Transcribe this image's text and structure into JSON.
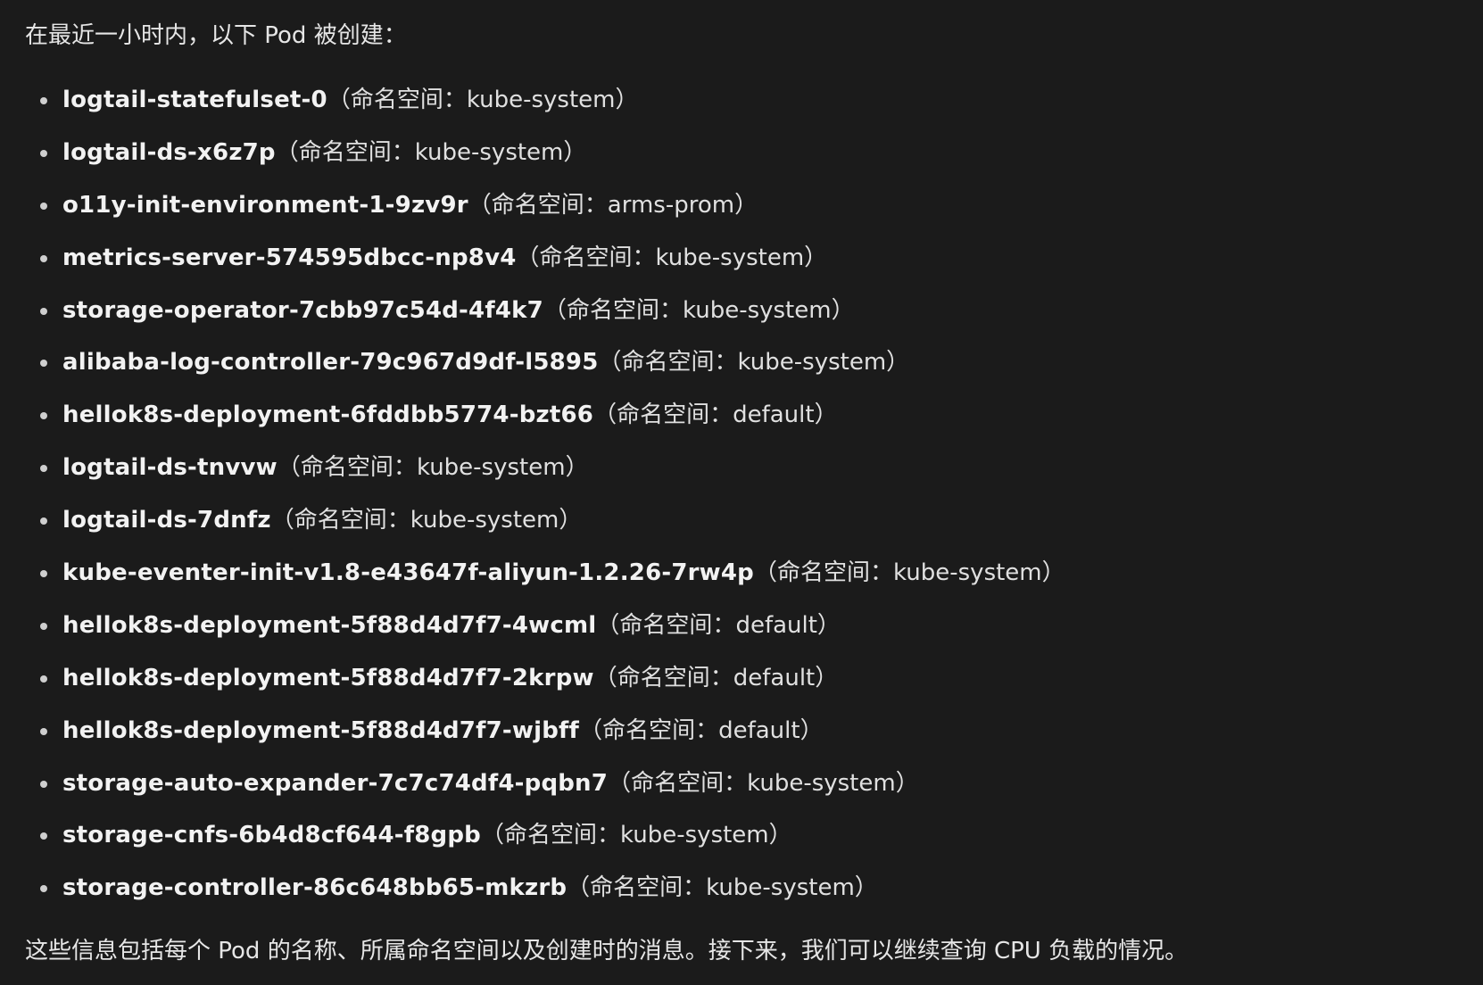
{
  "intro": "在最近一小时内，以下 Pod 被创建：",
  "ns_prefix": "（命名空间：",
  "ns_suffix": "）",
  "pods": [
    {
      "name": "logtail-statefulset-0",
      "namespace": "kube-system"
    },
    {
      "name": "logtail-ds-x6z7p",
      "namespace": "kube-system"
    },
    {
      "name": "o11y-init-environment-1-9zv9r",
      "namespace": "arms-prom"
    },
    {
      "name": "metrics-server-574595dbcc-np8v4",
      "namespace": "kube-system"
    },
    {
      "name": "storage-operator-7cbb97c54d-4f4k7",
      "namespace": "kube-system"
    },
    {
      "name": "alibaba-log-controller-79c967d9df-l5895",
      "namespace": "kube-system"
    },
    {
      "name": "hellok8s-deployment-6fddbb5774-bzt66",
      "namespace": "default"
    },
    {
      "name": "logtail-ds-tnvvw",
      "namespace": "kube-system"
    },
    {
      "name": "logtail-ds-7dnfz",
      "namespace": "kube-system"
    },
    {
      "name": "kube-eventer-init-v1.8-e43647f-aliyun-1.2.26-7rw4p",
      "namespace": "kube-system"
    },
    {
      "name": "hellok8s-deployment-5f88d4d7f7-4wcml",
      "namespace": "default"
    },
    {
      "name": "hellok8s-deployment-5f88d4d7f7-2krpw",
      "namespace": "default"
    },
    {
      "name": "hellok8s-deployment-5f88d4d7f7-wjbff",
      "namespace": "default"
    },
    {
      "name": "storage-auto-expander-7c7c74df4-pqbn7",
      "namespace": "kube-system"
    },
    {
      "name": "storage-cnfs-6b4d8cf644-f8gpb",
      "namespace": "kube-system"
    },
    {
      "name": "storage-controller-86c648bb65-mkzrb",
      "namespace": "kube-system"
    }
  ],
  "summary": "这些信息包括每个 Pod 的名称、所属命名空间以及创建时的消息。接下来，我们可以继续查询 CPU 负载的情况。"
}
